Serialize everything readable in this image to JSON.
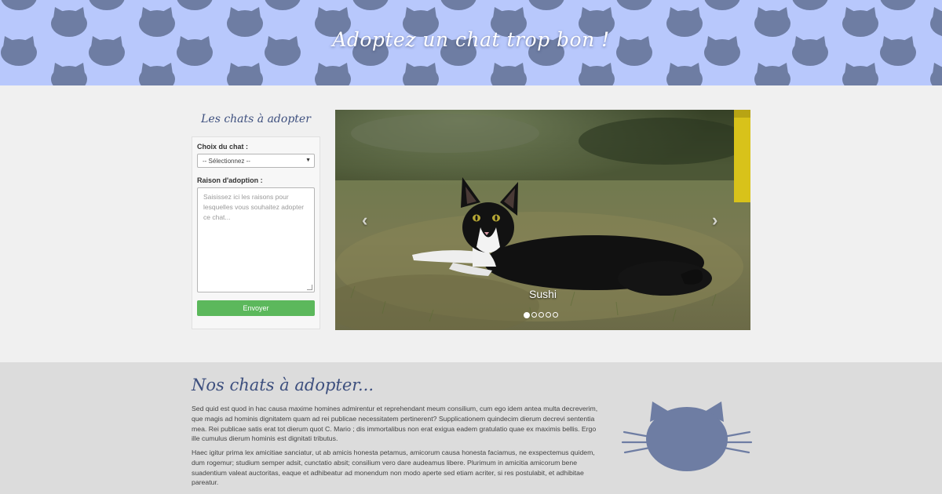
{
  "header": {
    "title": "Adoptez un chat trop bon !",
    "background_color": "#b8c8fc",
    "pattern_icon": "cat-head-icon",
    "pattern_color": "#6e7da3"
  },
  "sidebar": {
    "title": "Les chats à adopter",
    "form": {
      "cat_choice_label": "Choix du chat :",
      "cat_choice_value": "-- Sélectionnez --",
      "reason_label": "Raison d'adoption :",
      "reason_placeholder": "Saisissez ici les raisons pour lesquelles vous souhaitez adopter ce chat...",
      "submit_label": "Envoyer",
      "submit_color": "#5cb85c"
    }
  },
  "carousel": {
    "caption": "Sushi",
    "prev_icon": "chevron-left-icon",
    "next_icon": "chevron-right-icon",
    "slide_count": 5,
    "active_index": 0
  },
  "about": {
    "title": "Nos chats à adopter...",
    "paragraph1": "Sed quid est quod in hac causa maxime homines admirentur et reprehendant meum consilium, cum ego idem antea multa decreverim, que magis ad hominis dignitatem quam ad rei publicae necessitatem pertinerent? Supplicationem quindecim dierum decrevi sententia mea. Rei publicae satis erat tot dierum quot C. Mario ; dis immortalibus non erat exigua eadem gratulatio quae ex maximis bellis. Ergo ille cumulus dierum hominis est dignitati tributus.",
    "paragraph2": "Haec igitur prima lex amicitiae sanciatur, ut ab amicis honesta petamus, amicorum causa honesta faciamus, ne exspectemus quidem, dum rogemur; studium semper adsit, cunctatio absit; consilium vero dare audeamus libere. Plurimum in amicitia amicorum bene suadentium valeat auctoritas, eaque et adhibeatur ad monendum non modo aperte sed etiam acriter, si res postulabit, et adhibitae pareatur.",
    "logo_icon": "cat-head-icon",
    "logo_color": "#6e7da3"
  }
}
